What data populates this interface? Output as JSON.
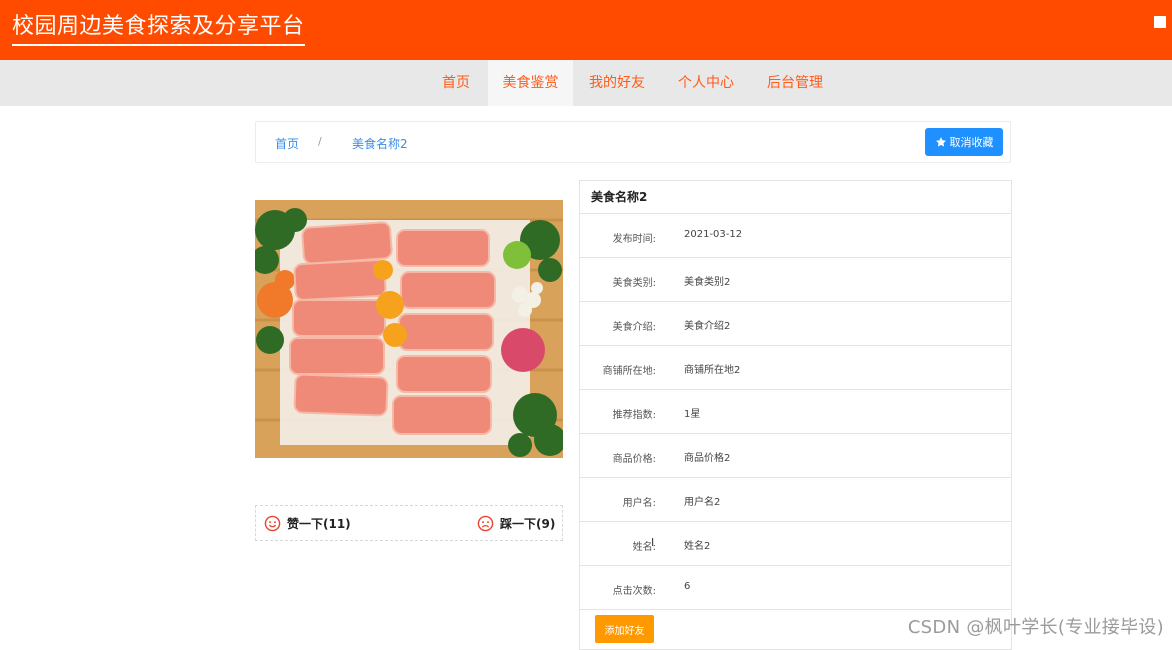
{
  "header": {
    "site_title": "校园周边美食探索及分享平台"
  },
  "nav": {
    "items": [
      {
        "label": "首页"
      },
      {
        "label": "美食鉴赏"
      },
      {
        "label": "我的好友"
      },
      {
        "label": "个人中心"
      },
      {
        "label": "后台管理"
      }
    ],
    "active_index": 1
  },
  "breadcrumb": {
    "home": "首页",
    "separator": "/",
    "current": "美食名称2"
  },
  "favorite": {
    "label": "取消收藏",
    "icon": "star-icon"
  },
  "votes": {
    "like_label": "赞一下(11)",
    "dislike_label": "踩一下(9)",
    "like_icon": "smile-icon",
    "dislike_icon": "frown-icon"
  },
  "detail": {
    "title": "美食名称2",
    "rows": [
      {
        "label": "发布时间:",
        "value": "2021-03-12"
      },
      {
        "label": "美食类别:",
        "value": "美食类别2"
      },
      {
        "label": "美食介绍:",
        "value": "美食介绍2"
      },
      {
        "label": "商铺所在地:",
        "value": "商铺所在地2"
      },
      {
        "label": "推荐指数:",
        "value": "1星"
      },
      {
        "label": "商品价格:",
        "value": "商品价格2"
      },
      {
        "label": "用户名:",
        "value": "用户名2"
      },
      {
        "label": "姓名:",
        "value": "姓名2"
      },
      {
        "label": "点击次数:",
        "value": "6"
      }
    ],
    "add_friend_label": "添加好友"
  },
  "watermark": "CSDN @枫叶学长(专业接毕设)",
  "colors": {
    "header": "#ff4b00",
    "nav_text": "#ff5b1a",
    "primary_button": "#1e90ff",
    "add_button": "#ff9900",
    "vote_icon": "#e8452c"
  }
}
